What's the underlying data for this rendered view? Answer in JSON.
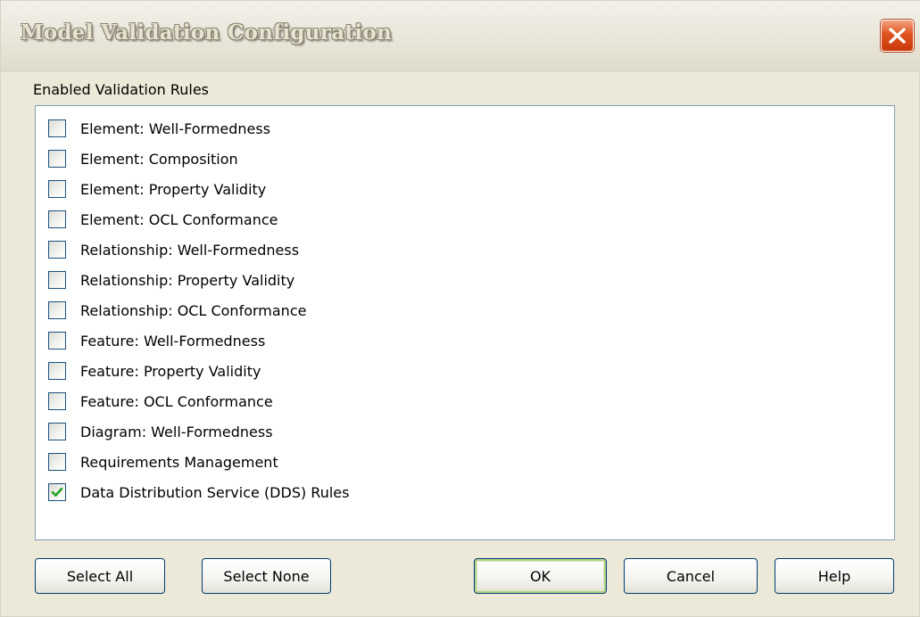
{
  "window": {
    "title": "Model Validation Configuration",
    "close_icon": "close-icon"
  },
  "section_label": "Enabled Validation Rules",
  "rules": [
    {
      "label": "Element: Well-Formedness",
      "checked": false
    },
    {
      "label": "Element: Composition",
      "checked": false
    },
    {
      "label": "Element: Property Validity",
      "checked": false
    },
    {
      "label": "Element: OCL Conformance",
      "checked": false
    },
    {
      "label": "Relationship: Well-Formedness",
      "checked": false
    },
    {
      "label": "Relationship: Property Validity",
      "checked": false
    },
    {
      "label": "Relationship: OCL Conformance",
      "checked": false
    },
    {
      "label": "Feature: Well-Formedness",
      "checked": false
    },
    {
      "label": "Feature: Property Validity",
      "checked": false
    },
    {
      "label": "Feature: OCL Conformance",
      "checked": false
    },
    {
      "label": "Diagram: Well-Formedness",
      "checked": false
    },
    {
      "label": "Requirements Management",
      "checked": false
    },
    {
      "label": "Data Distribution Service (DDS) Rules",
      "checked": true
    }
  ],
  "buttons": {
    "select_all": "Select All",
    "select_none": "Select None",
    "ok": "OK",
    "cancel": "Cancel",
    "help": "Help"
  },
  "colors": {
    "check_mark": "#21a121",
    "close_button": "#e0531f",
    "dialog_background": "#ece9d8"
  }
}
